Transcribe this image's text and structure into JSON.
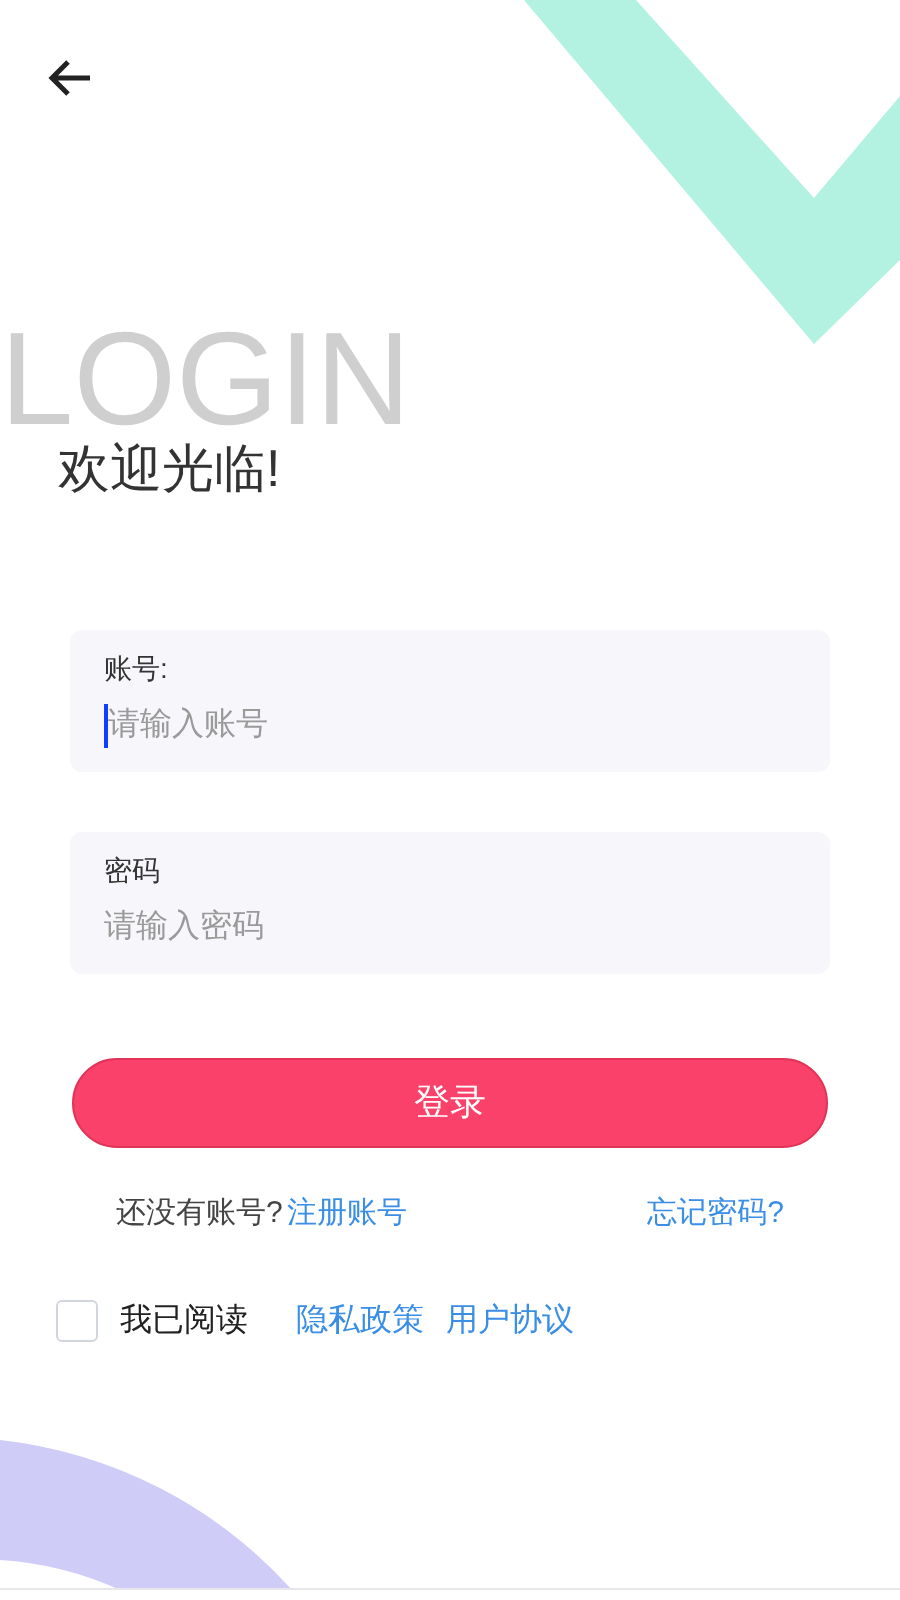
{
  "watermark": "LOGIN",
  "title": "欢迎光临!",
  "fields": [
    {
      "label": "账号:",
      "placeholder": "请输入账号",
      "focused": true
    },
    {
      "label": "密码",
      "placeholder": "请输入密码",
      "focused": false
    }
  ],
  "login_button": "登录",
  "register_prompt": "还没有账号?",
  "register_link": "注册账号",
  "forgot_link": "忘记密码?",
  "agreement": {
    "checked": false,
    "label": "我已阅读",
    "links": [
      "隐私政策",
      "用户协议"
    ]
  }
}
